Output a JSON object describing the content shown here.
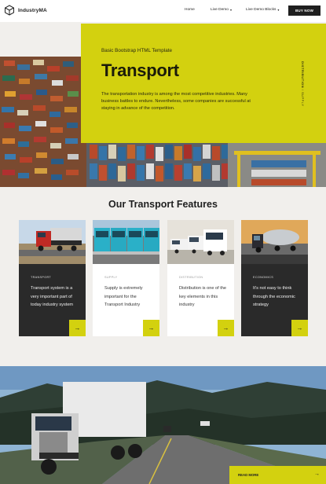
{
  "nav": {
    "brand": "IndustryMA",
    "links": [
      {
        "label": "Home",
        "caret": ""
      },
      {
        "label": "Live Demo",
        "caret": "▾"
      },
      {
        "label": "Live Demo Blocks",
        "caret": "▾"
      }
    ],
    "buy_label": "BUY NOW"
  },
  "hero": {
    "kicker": "Basic Bootstrap HTML Template",
    "title": "Transport",
    "description": "The transportation industry is among the most competitive industries. Many business battles to endure. Nevertheless, some companies are successful at staying in advance of the competition.",
    "vertical_bold": "DISTRIBUTION",
    "vertical_rest": " / SUPPLY",
    "accent_color": "#d3d10f"
  },
  "features": {
    "title": "Our Transport Features",
    "cards": [
      {
        "tag": "TRANSPORT",
        "text": "Transport system is a very important part of today industry system",
        "theme": "dark",
        "arrow": "→"
      },
      {
        "tag": "SUPPLY",
        "text": "Supply is extremely important for the Transport Industry",
        "theme": "light",
        "arrow": "→"
      },
      {
        "tag": "DISTRIBUTION",
        "text": "Distribution is one of the key elements in this industry",
        "theme": "light",
        "arrow": "→"
      },
      {
        "tag": "ECONOMICS",
        "text": "It's not easy to think through the economic strategy",
        "theme": "dark",
        "arrow": "→"
      }
    ]
  },
  "cta": {
    "label": "READ MORE",
    "arrow": "→"
  }
}
